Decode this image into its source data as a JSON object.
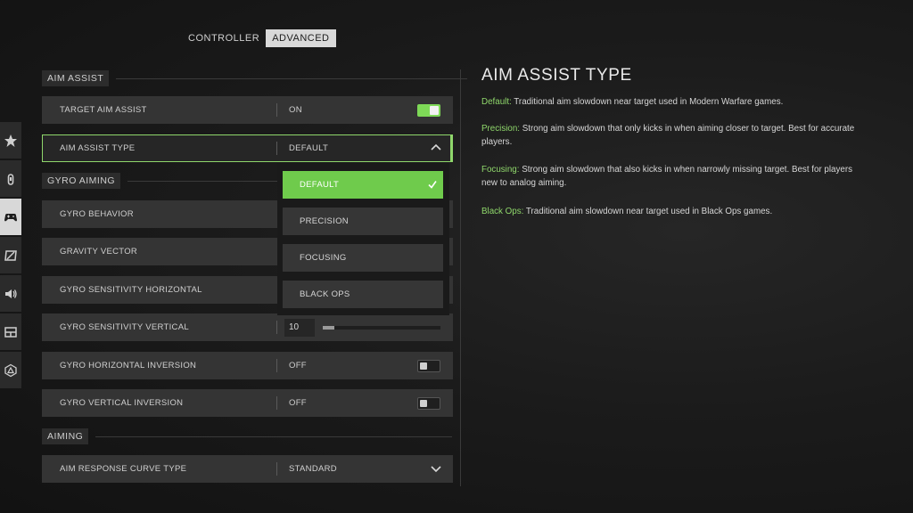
{
  "tabs": [
    {
      "label": "CONTROLLER",
      "active": false
    },
    {
      "label": "ADVANCED",
      "active": true
    }
  ],
  "rail": [
    {
      "icon": "star-icon",
      "active": false
    },
    {
      "icon": "ammo-icon",
      "active": false
    },
    {
      "icon": "gamepad-icon",
      "active": true
    },
    {
      "icon": "display-icon",
      "active": false
    },
    {
      "icon": "speaker-icon",
      "active": false
    },
    {
      "icon": "interface-icon",
      "active": false
    },
    {
      "icon": "network-icon",
      "active": false
    }
  ],
  "sections": {
    "aim_assist": "AIM ASSIST",
    "gyro_aiming": "GYRO AIMING",
    "aiming": "AIMING"
  },
  "rows": {
    "target_aim_assist": {
      "name": "TARGET AIM ASSIST",
      "value": "ON",
      "toggle": true
    },
    "aim_assist_type": {
      "name": "AIM ASSIST TYPE",
      "value": "DEFAULT"
    },
    "gyro_behavior": {
      "name": "GYRO BEHAVIOR"
    },
    "gravity_vector": {
      "name": "GRAVITY VECTOR"
    },
    "gyro_sens_h": {
      "name": "GYRO SENSITIVITY HORIZONTAL"
    },
    "gyro_sens_v": {
      "name": "GYRO SENSITIVITY VERTICAL",
      "value": "10",
      "slider_fraction": 0.1
    },
    "gyro_h_inv": {
      "name": "GYRO HORIZONTAL INVERSION",
      "value": "OFF",
      "toggle": false
    },
    "gyro_v_inv": {
      "name": "GYRO VERTICAL INVERSION",
      "value": "OFF",
      "toggle": false
    },
    "aim_response_curve": {
      "name": "AIM RESPONSE CURVE TYPE",
      "value": "STANDARD"
    }
  },
  "dropdown": {
    "options": [
      "DEFAULT",
      "PRECISION",
      "FOCUSING",
      "BLACK OPS"
    ],
    "selected": "DEFAULT"
  },
  "info": {
    "title": "AIM ASSIST TYPE",
    "entries": [
      {
        "term": "Default:",
        "text": " Traditional aim slowdown near target used in Modern Warfare games."
      },
      {
        "term": "Precision:",
        "text": " Strong aim slowdown that only kicks in when aiming closer to target. Best for accurate players."
      },
      {
        "term": "Focusing:",
        "text": " Strong aim slowdown that also kicks in when narrowly missing target. Best for players new to analog aiming."
      },
      {
        "term": "Black Ops:",
        "text": " Traditional aim slowdown near target used in Black Ops games."
      }
    ]
  },
  "colors": {
    "accent": "#8fd76b",
    "toggle_on": "#7ed957",
    "selected_option": "#6fcb4c"
  }
}
